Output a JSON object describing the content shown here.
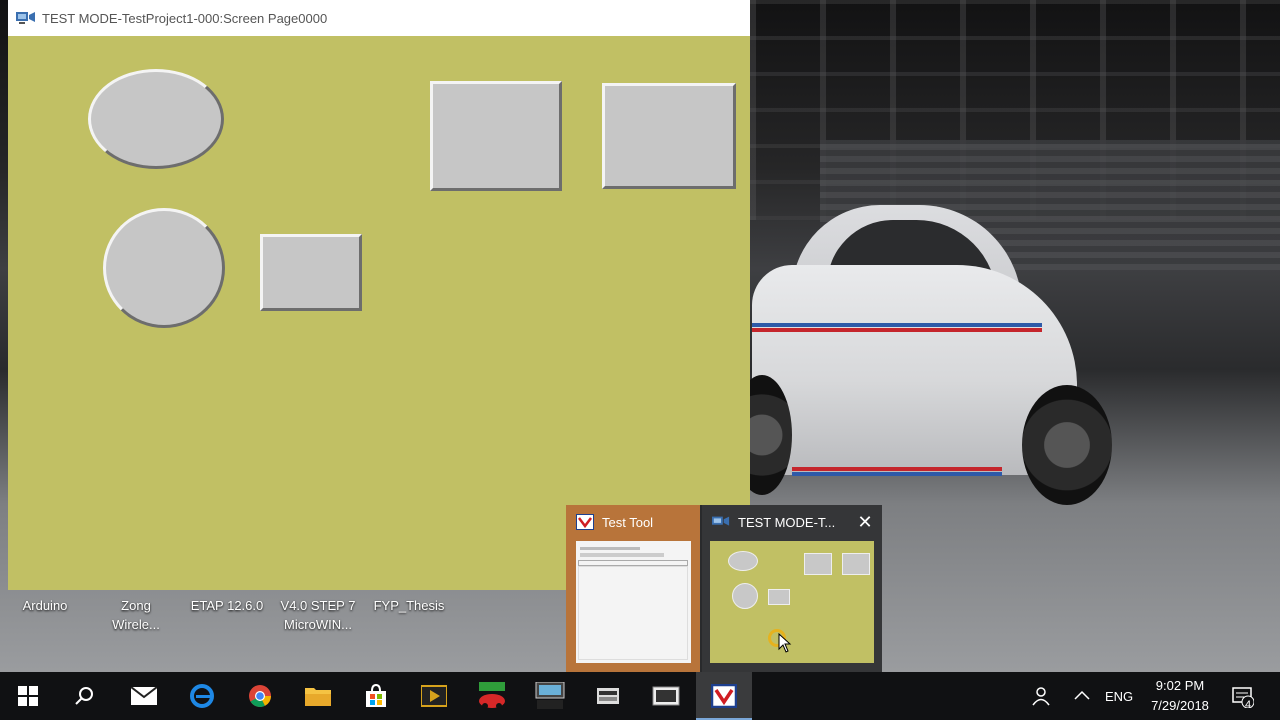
{
  "window": {
    "title": "TEST MODE-TestProject1-000:Screen Page0000",
    "background": "#c1c064"
  },
  "desktop": {
    "icons": [
      {
        "label_line1": "Arduino",
        "label_line2": ""
      },
      {
        "label_line1": "Zong",
        "label_line2": "Wirele..."
      },
      {
        "label_line1": "ETAP 12.6.0",
        "label_line2": ""
      },
      {
        "label_line1": "V4.0 STEP 7",
        "label_line2": "MicroWIN..."
      },
      {
        "label_line1": "FYP_Thesis",
        "label_line2": ""
      }
    ]
  },
  "thumbnails": {
    "items": [
      {
        "title": "Test Tool"
      },
      {
        "title": "TEST MODE-T..."
      }
    ],
    "close_glyph": "✕"
  },
  "taskbar": {
    "apps": [
      {
        "icon": "windows-start-icon"
      },
      {
        "icon": "search-icon"
      },
      {
        "icon": "mail-icon"
      },
      {
        "icon": "edge-icon"
      },
      {
        "icon": "chrome-icon"
      },
      {
        "icon": "file-explorer-icon"
      },
      {
        "icon": "store-icon"
      },
      {
        "icon": "media-app-icon"
      },
      {
        "icon": "modbus-app-icon"
      },
      {
        "icon": "cxd-app-icon"
      },
      {
        "icon": "plc-device-icon"
      },
      {
        "icon": "hmi-device-icon"
      },
      {
        "icon": "test-tool-icon"
      }
    ],
    "language": "ENG",
    "time": "9:02 PM",
    "date": "7/29/2018",
    "notification_count": "4"
  }
}
